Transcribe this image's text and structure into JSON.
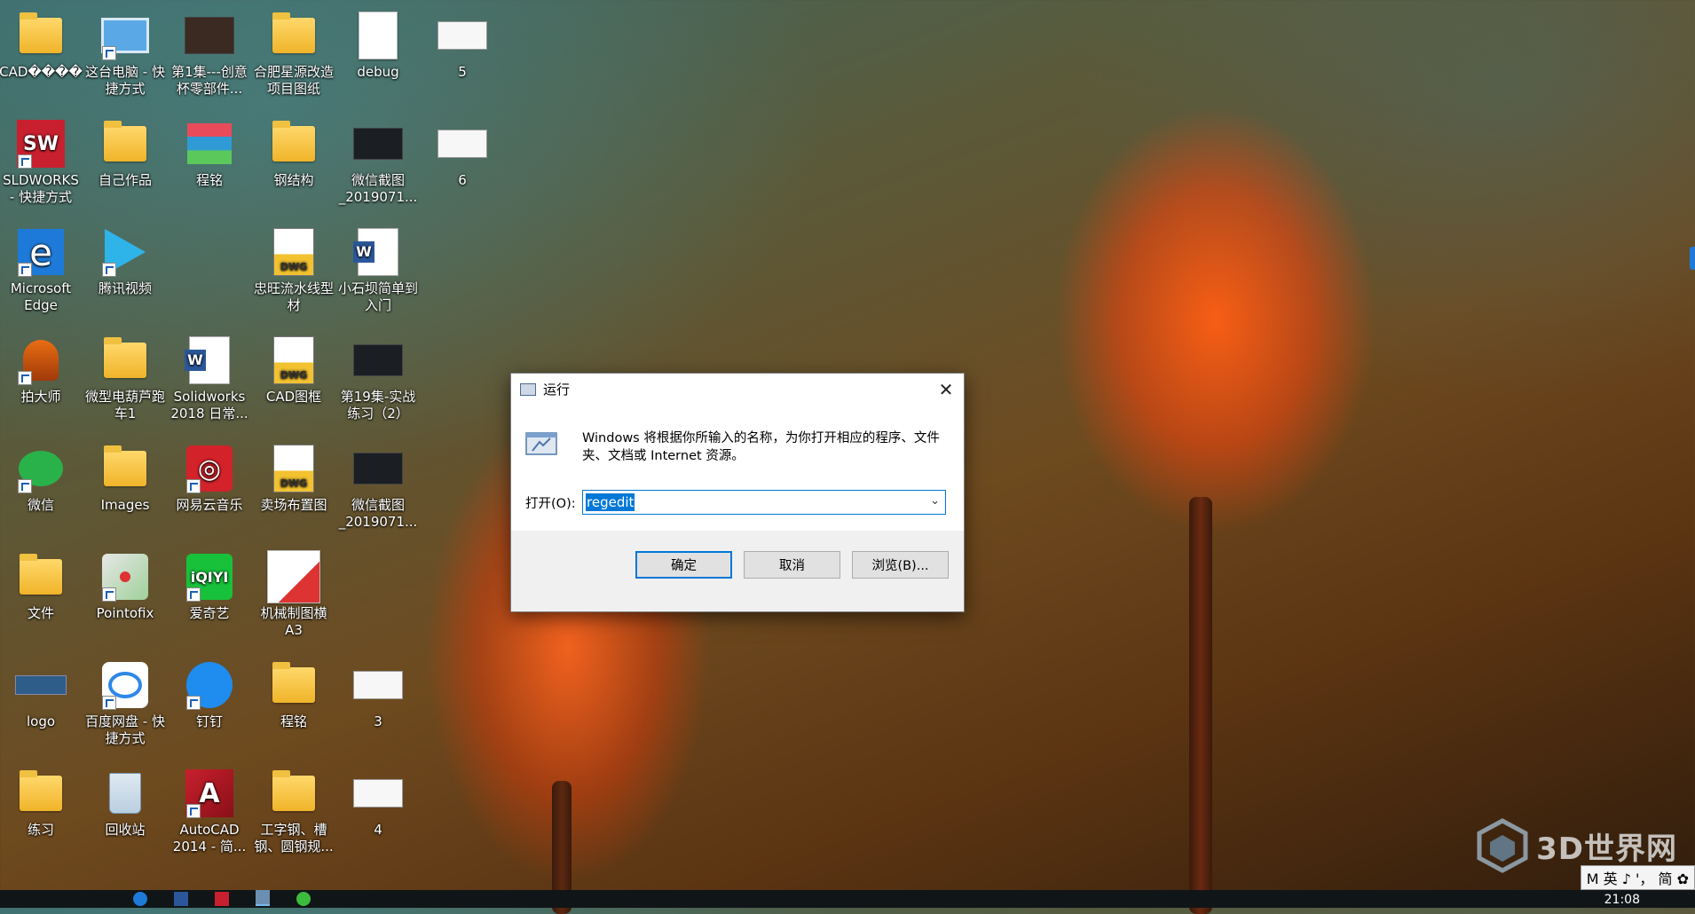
{
  "desktop": {
    "icons": [
      {
        "label": "CAD����"
      },
      {
        "label": "这台电脑 - 快捷方式"
      },
      {
        "label": "第1集---创意杯零部件..."
      },
      {
        "label": "合肥星源改造项目图纸"
      },
      {
        "label": "debug"
      },
      {
        "label": "5"
      },
      {
        "label": "SLDWORKS - 快捷方式"
      },
      {
        "label": "自己作品"
      },
      {
        "label": "程铭"
      },
      {
        "label": "钢结构"
      },
      {
        "label": "微信截图_2019071..."
      },
      {
        "label": "6"
      },
      {
        "label": "Microsoft Edge"
      },
      {
        "label": "腾讯视频"
      },
      {
        "label": "忠旺流水线型材"
      },
      {
        "label": "小石坝简单到入门"
      },
      {
        "label": "拍大师"
      },
      {
        "label": "微型电葫芦跑车1"
      },
      {
        "label": "Solidworks 2018 日常..."
      },
      {
        "label": "CAD图框"
      },
      {
        "label": "第19集-实战练习（2）"
      },
      {
        "label": "微信"
      },
      {
        "label": "Images"
      },
      {
        "label": "网易云音乐"
      },
      {
        "label": "卖场布置图"
      },
      {
        "label": "微信截图_2019071..."
      },
      {
        "label": "文件"
      },
      {
        "label": "Pointofix"
      },
      {
        "label": "爱奇艺"
      },
      {
        "label": "机械制图横A3"
      },
      {
        "label": "logo"
      },
      {
        "label": "百度网盘 - 快捷方式"
      },
      {
        "label": "钉钉"
      },
      {
        "label": "程铭"
      },
      {
        "label": "3"
      },
      {
        "label": "练习"
      },
      {
        "label": "回收站"
      },
      {
        "label": "AutoCAD 2014 - 简..."
      },
      {
        "label": "工字钢、槽钢、圆钢规..."
      },
      {
        "label": "4"
      }
    ]
  },
  "run_dialog": {
    "title": "运行",
    "close_glyph": "✕",
    "description": "Windows 将根据你所输入的名称，为你打开相应的程序、文件夹、文档或 Internet 资源。",
    "open_label": "打开(O):",
    "open_value": "regedit",
    "ok_label": "确定",
    "cancel_label": "取消",
    "browse_label": "浏览(B)..."
  },
  "taskbar": {
    "time": "21:08"
  },
  "ime": {
    "text": "M 英 ♪ '， 简 ✿"
  },
  "watermark": {
    "text": "3D世界网"
  },
  "colors": {
    "accent": "#0078d7",
    "dialog_footer": "#f0f0f0",
    "taskbar": "#101518"
  }
}
